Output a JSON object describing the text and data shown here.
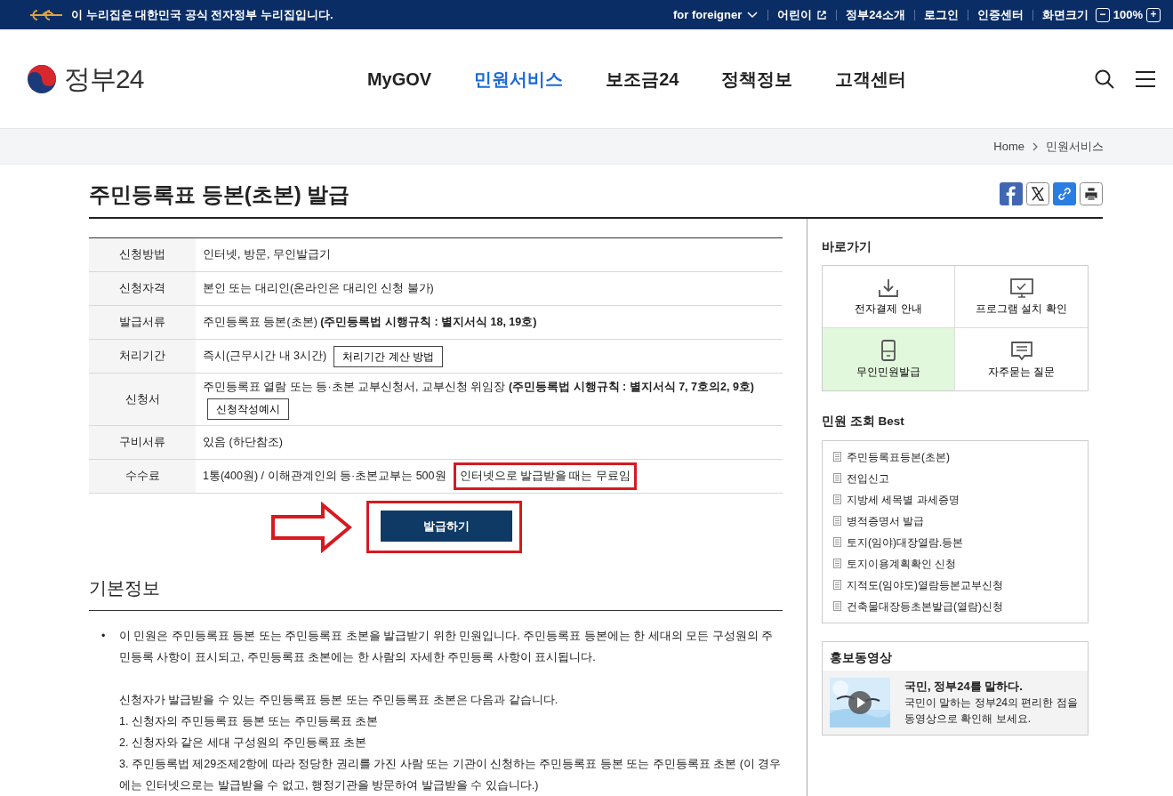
{
  "top_bar": {
    "notice": "이 누리집은 대한민국 공식 전자정부 누리집입니다.",
    "links": [
      {
        "label": "for foreigner",
        "kind": "dropdown"
      },
      {
        "label": "어린이",
        "kind": "external"
      },
      {
        "label": "정부24소개",
        "kind": "plain"
      },
      {
        "label": "로그인",
        "kind": "plain"
      },
      {
        "label": "인증센터",
        "kind": "plain"
      }
    ],
    "zoom": {
      "label": "화면크기",
      "minus": "−",
      "value": "100%",
      "plus": "+"
    }
  },
  "header": {
    "logo": "정부24",
    "nav": [
      {
        "label": "MyGOV",
        "selected": false
      },
      {
        "label": "민원서비스",
        "selected": true
      },
      {
        "label": "보조금24",
        "selected": false
      },
      {
        "label": "정책정보",
        "selected": false
      },
      {
        "label": "고객센터",
        "selected": false
      }
    ]
  },
  "breadcrumb": [
    "Home",
    "민원서비스"
  ],
  "page_title": "주민등록표 등본(초본) 발급",
  "share": [
    {
      "kind": "facebook"
    },
    {
      "kind": "x"
    },
    {
      "kind": "link"
    },
    {
      "kind": "print"
    }
  ],
  "info_table": [
    {
      "label": "신청방법",
      "text": "인터넷, 방문, 무인발급기"
    },
    {
      "label": "신청자격",
      "text": "본인 또는 대리인(온라인은 대리인 신청 불가)"
    },
    {
      "label": "발급서류",
      "text": "주민등록표 등본(초본) **(주민등록법 시행규칙 : 별지서식 18, 19호)**"
    },
    {
      "label": "처리기간",
      "text": "즉시(근무시간 내 3시간)",
      "button": "처리기간 계산 방법",
      "button_inline": true
    },
    {
      "label": "신청서",
      "text": "주민등록표 열람 또는 등·초본 교부신청서, 교부신청 위임장 **(주민등록법 시행규칙 : 별지서식 7, 7호의2, 9호)**",
      "button": "신청작성예시",
      "button_inline": false
    },
    {
      "label": "구비서류",
      "text": "있음 (하단참조)"
    },
    {
      "label": "수수료",
      "text": "1통(400원) / 이해관계인의 등·초본교부는 500원",
      "note": "인터넷으로 발급받을 때는 무료임",
      "highlighted": true
    }
  ],
  "issue_button": {
    "label": "발급하기",
    "highlighted": true
  },
  "basic_info": {
    "heading": "기본정보",
    "bullet": "•",
    "paragraphs": [
      "이 민원은 주민등록표 등본 또는 주민등록표 초본을 발급받기 위한 민원입니다. 주민등록표 등본에는 한 세대의 모든 구성원의 주민등록 사항이 표시되고, 주민등록표 초본에는 한 사람의 자세한 주민등록 사항이 표시됩니다."
    ],
    "lines": [
      "신청자가 발급받을 수 있는 주민등록표 등본 또는 주민등록표 초본은 다음과 같습니다.",
      "1. 신청자의 주민등록표 등본 또는 주민등록표 초본",
      "2. 신청자와 같은 세대 구성원의 주민등록표 초본",
      "3. 주민등록법 제29조제2항에 따라 정당한 권리를 가진 사람 또는 기관이 신청하는 주민등록표 등본 또는 주민등록표 초본 (이 경우에는 인터넷으로는 발급받을 수 없고, 행정기관을 방문하여 발급받을 수 있습니다.)"
    ]
  },
  "sidebar": {
    "shortcuts_title": "바로가기",
    "shortcuts": [
      {
        "label": "전자결제 안내",
        "kind": "download",
        "selected": false
      },
      {
        "label": "프로그램 설치 확인",
        "kind": "monitor",
        "selected": false
      },
      {
        "label": "무인민원발급",
        "kind": "kiosk",
        "selected": true
      },
      {
        "label": "자주묻는 질문",
        "kind": "chat",
        "selected": false
      }
    ],
    "best_title": "민원 조회 Best",
    "best": [
      "주민등록표등본(초본)",
      "전입신고",
      "지방세 세목별 과세증명",
      "병적증명서 발급",
      "토지(임야)대장열람.등본",
      "토지이용계획확인 신청",
      "지적도(임야도)열람등본교부신청",
      "건축물대장등초본발급(열람)신청"
    ],
    "video": {
      "title": "홍보동영상",
      "headline": "국민, 정부24를 말하다.",
      "description": "국민이 말하는 정부24의 편리한 점을 동영상으로 확인해 보세요.",
      "kind": "picture"
    }
  }
}
